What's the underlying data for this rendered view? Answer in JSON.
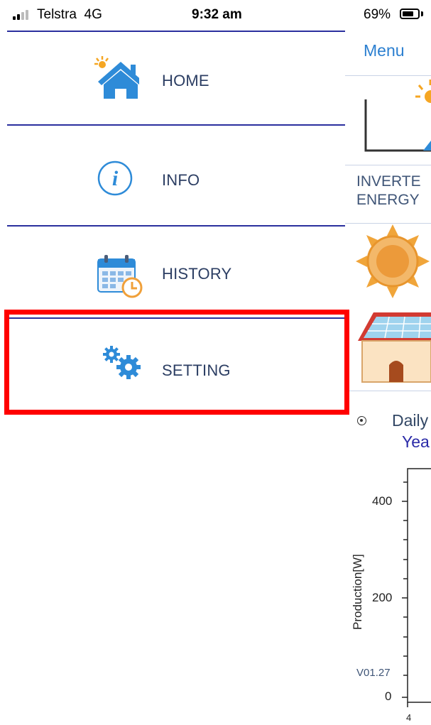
{
  "status_bar": {
    "carrier": "Telstra",
    "network": "4G",
    "time": "9:32 am",
    "battery_percent": "69%",
    "battery_level": 0.69,
    "signal_bars": 2
  },
  "side_menu": {
    "items": [
      {
        "label": "HOME",
        "icon": "home-icon",
        "selected": false
      },
      {
        "label": "INFO",
        "icon": "info-icon",
        "selected": false
      },
      {
        "label": "HISTORY",
        "icon": "calendar-clock-icon",
        "selected": false
      },
      {
        "label": "SETTING",
        "icon": "gears-icon",
        "selected": true
      }
    ],
    "highlight_color": "#ff0000",
    "divider_color": "#2a2f9e",
    "label_color": "#2c3e63",
    "icon_color": "#2e8bd8"
  },
  "background_app": {
    "menu_label": "Menu",
    "inverter_line1": "INVERTE",
    "inverter_line2": "ENERGY",
    "daily_label": "Daily",
    "year_label": "Yea",
    "chart": {
      "ylabel": "Production[W]",
      "y_ticks": [
        "400",
        "200",
        "0"
      ],
      "x_tick": "4"
    },
    "version": "V01.27"
  }
}
